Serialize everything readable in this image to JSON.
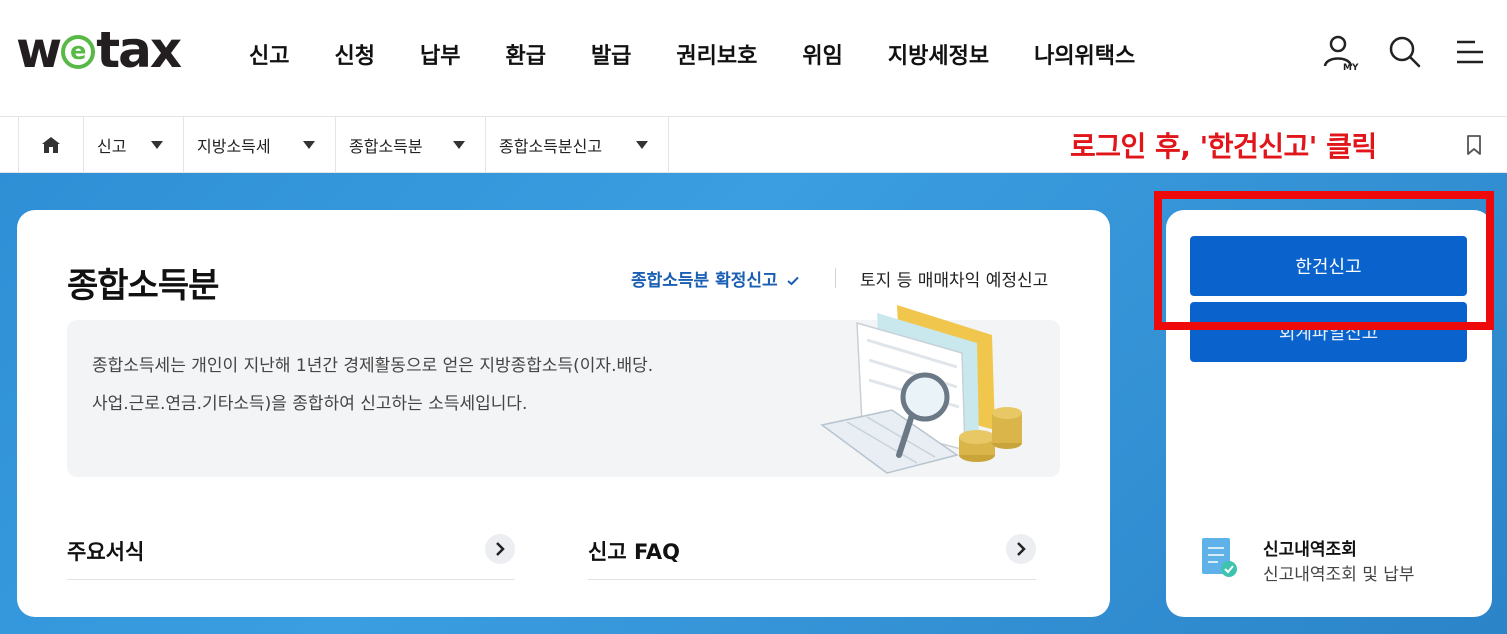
{
  "header": {
    "logo_prefix": "w",
    "logo_e": "e",
    "logo_suffix": "tax",
    "nav": [
      "신고",
      "신청",
      "납부",
      "환급",
      "발급",
      "권리보호",
      "위임",
      "지방세정보",
      "나의위택스"
    ],
    "my_badge": "MY"
  },
  "breadcrumb": {
    "items": [
      "신고",
      "지방소득세",
      "종합소득분",
      "종합소득분신고"
    ]
  },
  "annotation": "로그인 후, '한건신고' 클릭",
  "main": {
    "title": "종합소득분",
    "tab_active": "종합소득분 확정신고",
    "tab_other": "토지 등 매매차익 예정신고",
    "description_line1": "종합소득세는 개인이 지난해 1년간 경제활동으로 얻은 지방종합소득(이자.배당.",
    "description_line2": "사업.근로.연금.기타소득)을 종합하여 신고하는 소득세입니다.",
    "links": [
      "주요서식",
      "신고 FAQ"
    ]
  },
  "side": {
    "button_single": "한건신고",
    "button_bulk": "회계파일신고",
    "history_title": "신고내역조회",
    "history_sub": "신고내역조회 및 납부"
  },
  "colors": {
    "accent": "#0a63cc",
    "annotation": "#e0161b",
    "banner": "#3a9ee0",
    "logo_green": "#58b947"
  }
}
